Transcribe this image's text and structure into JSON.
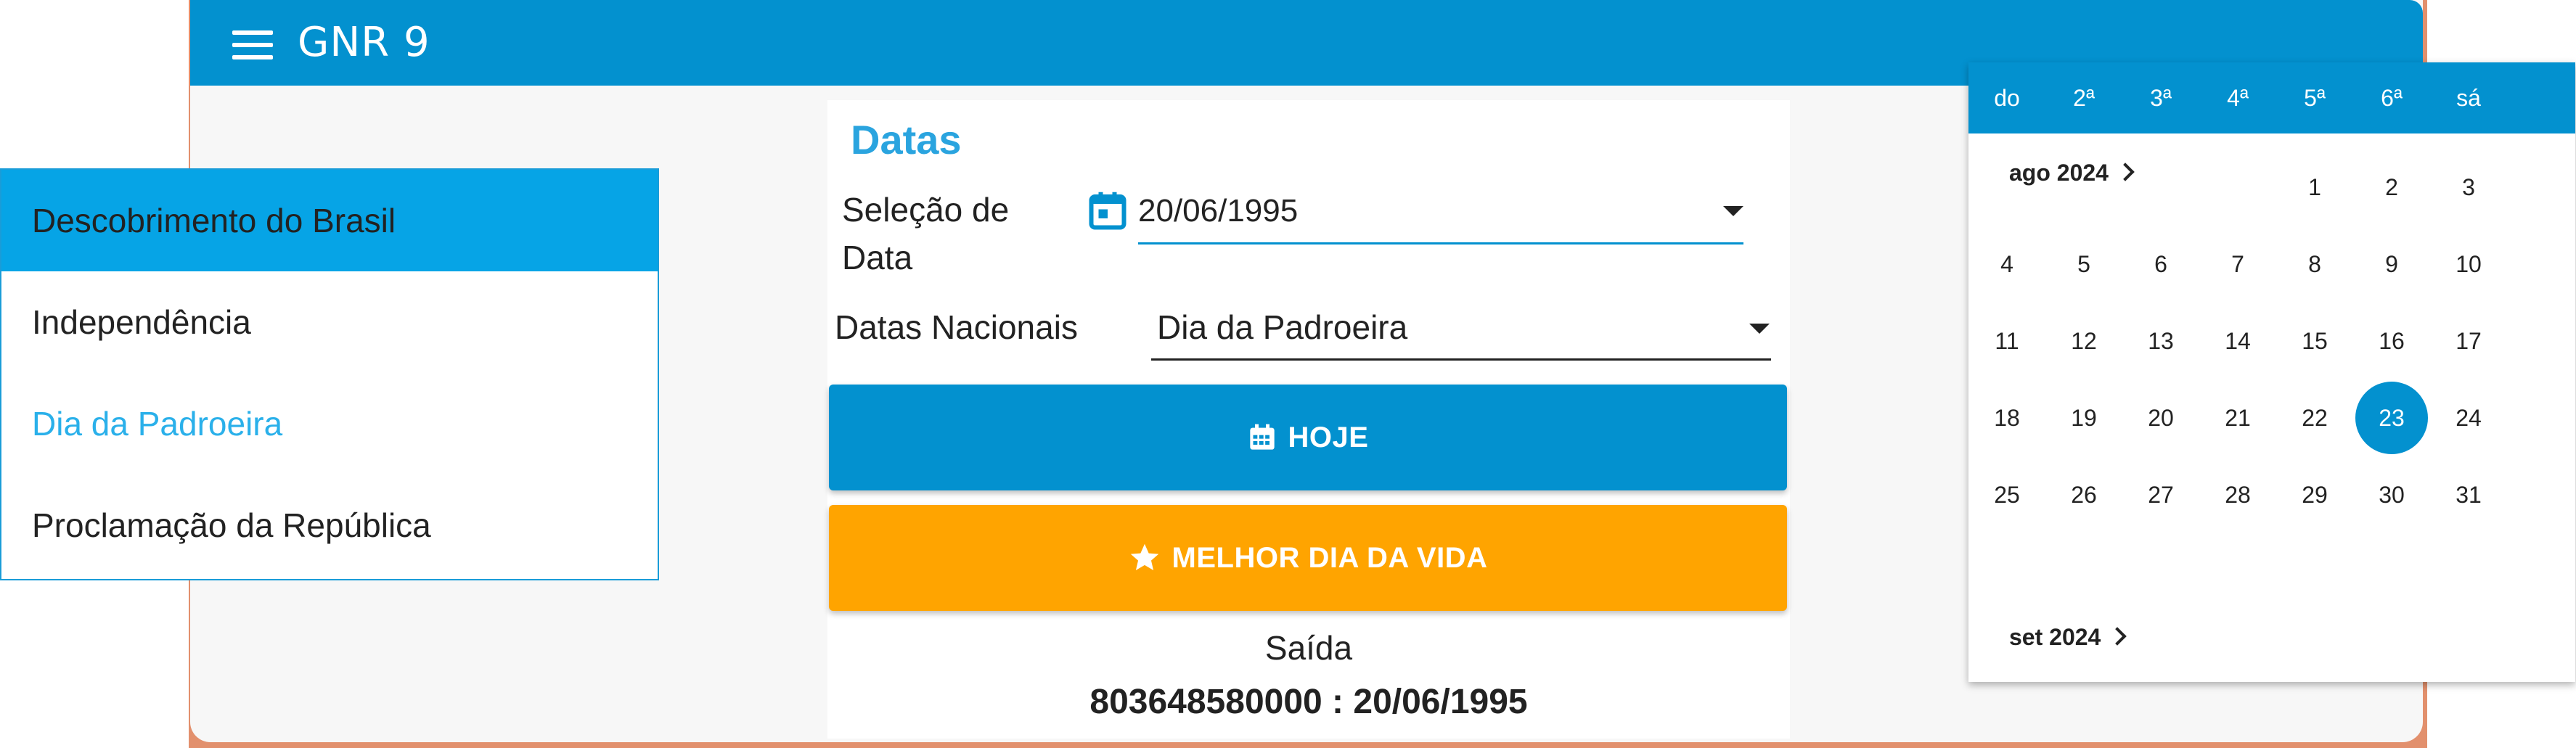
{
  "app": {
    "title": "GNR 9"
  },
  "card": {
    "title": "Datas",
    "date_label": "Seleção de Data",
    "date_value": "20/06/1995",
    "national_label": "Datas Nacionais",
    "national_value": "Dia da Padroeira",
    "today_button": "HOJE",
    "best_day_button": "MELHOR DIA DA VIDA",
    "output_label": "Saída",
    "output_value": "803648580000 : 20/06/1995"
  },
  "national_menu": {
    "items": [
      {
        "label": "Descobrimento do Brasil",
        "state": "selected"
      },
      {
        "label": "Independência",
        "state": "normal"
      },
      {
        "label": "Dia da Padroeira",
        "state": "highlight"
      },
      {
        "label": "Proclamação da República",
        "state": "normal"
      }
    ]
  },
  "datepicker": {
    "weekdays": [
      "do",
      "2ª",
      "3ª",
      "4ª",
      "5ª",
      "6ª",
      "sá"
    ],
    "month_label": "ago 2024",
    "next_month_label": "set 2024",
    "first_weekday_index": 4,
    "days_in_month": 31,
    "selected_day": 23
  },
  "colors": {
    "primary": "#0391cf",
    "accent_orange": "#ffa400",
    "menu_selected": "#06a4e6",
    "title_blue": "#2aa4df"
  },
  "icons": [
    "menu-icon",
    "calendar-icon",
    "calendar-grid-icon",
    "star-icon",
    "chevron-right-icon",
    "dropdown-arrow-icon"
  ]
}
